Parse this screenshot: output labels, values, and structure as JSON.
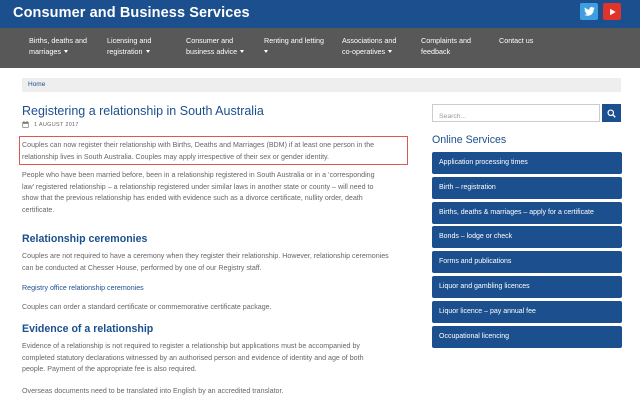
{
  "header": {
    "site_title": "Consumer and Business Services",
    "social": [
      {
        "icon": "twitter-icon",
        "color": "#3d9fe0"
      },
      {
        "icon": "youtube-icon",
        "color": "#e0332b"
      }
    ]
  },
  "nav": {
    "items": [
      {
        "line1": "Births, deaths and",
        "line2": "marriages",
        "has_dropdown": true
      },
      {
        "line1": "Licensing and",
        "line2": "registration",
        "has_dropdown": true
      },
      {
        "line1": "Consumer and",
        "line2": "business advice",
        "has_dropdown": true
      },
      {
        "line1": "Renting and letting",
        "line2": "",
        "has_dropdown": true
      },
      {
        "line1": "Associations and",
        "line2": "co-operatives",
        "has_dropdown": true
      },
      {
        "line1": "Complaints and",
        "line2": "feedback",
        "has_dropdown": false
      },
      {
        "line1": "Contact us",
        "line2": "",
        "has_dropdown": false
      }
    ]
  },
  "breadcrumb": {
    "home": "Home"
  },
  "article": {
    "title": "Registering a relationship in South Australia",
    "date": "1 AUGUST 2017",
    "intro_line1": "Couples can now register their relationship with Births, Deaths and Marriages (BDM) if at least one person in the",
    "intro_line2": "relationship lives in South Australia. Couples may apply irrespective of their sex or gender identity.",
    "para2_line1": "People who have been married before, been in a relationship registered in South Australia or in a ‘corresponding",
    "para2_line2": "law’ registered relationship – a relationship registered under similar laws in another state or county –  will need to",
    "para2_line3": "show that the previous relationship has ended with evidence such as a divorce certificate, nullity order, death",
    "para2_line4": "certificate.",
    "heading_ceremonies": "Relationship ceremonies",
    "ceremonies_line1": "Couples are not required to have a ceremony when they register their relationship. However, relationship ceremonies",
    "ceremonies_line2": "can be conducted at Chesser House, performed by one of our Registry staff.",
    "registry_link": "Registry office relationship ceremonies",
    "certificate_text": "Couples can order a standard certificate or commemorative certificate package.",
    "heading_evidence": "Evidence of a relationship",
    "evidence_line1": "Evidence of a relationship is not required to register a relationship but applications must be accompanied by",
    "evidence_line2": "completed statutory declarations witnessed by an authorised person and  evidence of identity and age of both",
    "evidence_line3": "people. Payment of the appropriate fee is also required.",
    "overseas_text": "Overseas documents need to be translated into English by an accredited translator."
  },
  "sidebar": {
    "search_placeholder": "Search...",
    "online_services_title": "Online Services",
    "services": [
      "Application processing times",
      "Birth – registration",
      "Births, deaths & marriages – apply for a certificate",
      "Bonds – lodge or check",
      "Forms and publications",
      "Liquor and gambling licences",
      "Liquor licence – pay annual fee",
      "Occupational licencing"
    ]
  },
  "colors": {
    "brand_blue": "#1c4f8e",
    "nav_gray": "#585858",
    "highlight_red": "#e0574f"
  }
}
